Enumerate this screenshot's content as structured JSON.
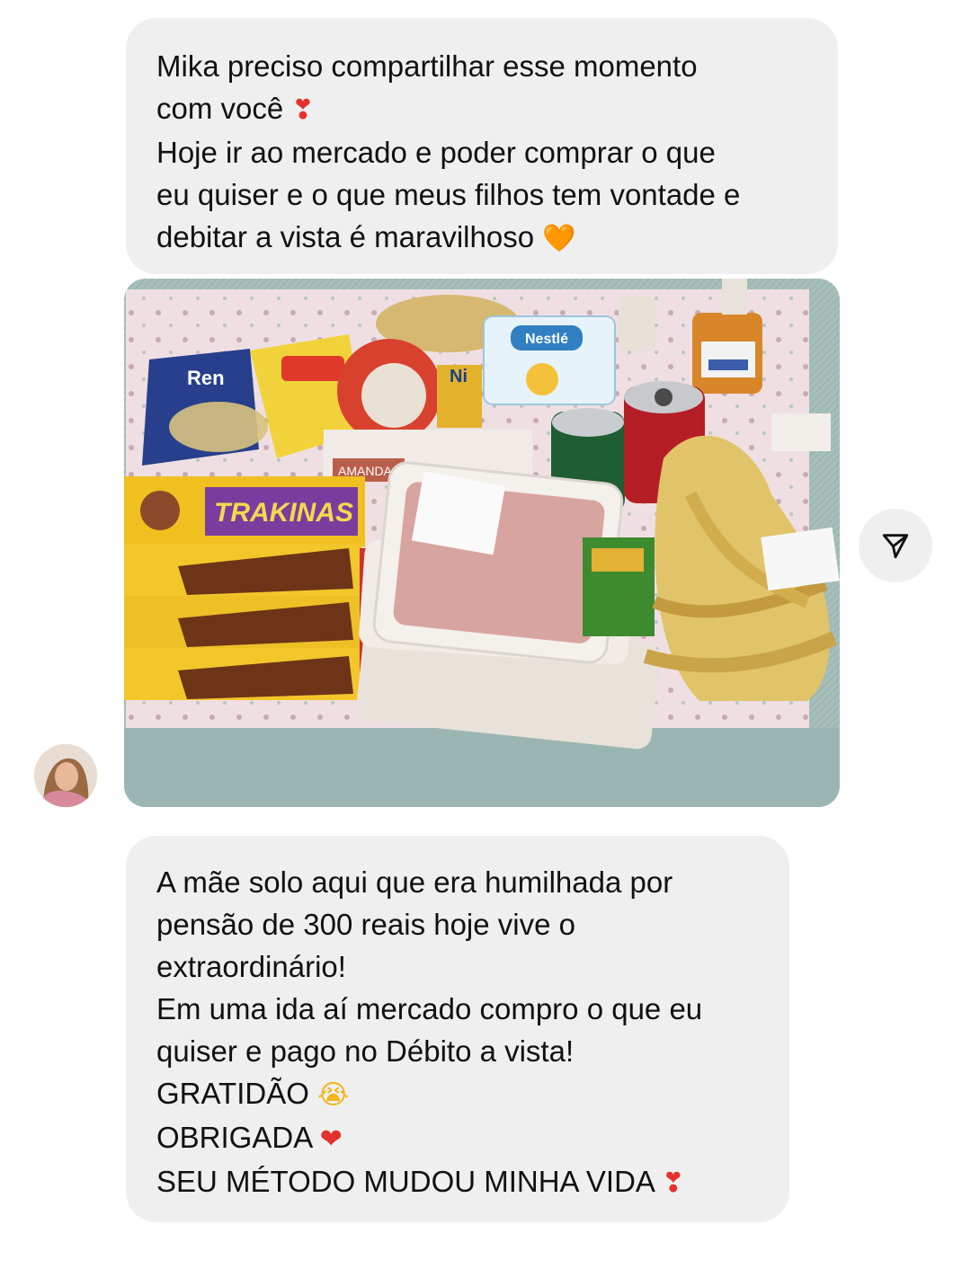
{
  "messages": [
    {
      "lines": [
        "Mika preciso compartilhar esse momento",
        "com você",
        "Hoje ir ao mercado e poder comprar o que",
        "eu quiser e o que meus filhos tem vontade e",
        "debitar a vista é maravilhoso"
      ],
      "emoji": [
        "❣",
        "🧡"
      ]
    },
    {
      "lines": [
        "A mãe solo aqui que era humilhada por",
        "pensão de 300 reais hoje vive o",
        "extraordinário!",
        "Em uma ida aí mercado compro o que eu",
        "quiser e pago no Débito a vista!",
        "GRATIDÃO",
        "OBRIGADA",
        "SEU MÉTODO MUDOU MINHA VIDA"
      ],
      "emoji": [
        "😭",
        "❤",
        "❣"
      ]
    }
  ],
  "photo": {
    "label_text": {
      "ren": "Ren",
      "nestle": "Nestlé",
      "ni": "Ni",
      "amanda": "AMANDA",
      "trakinas": "TRAKINAS"
    }
  },
  "icons": {
    "share": "paper-plane-icon",
    "avatar": "avatar"
  },
  "colors": {
    "bubble": "#efefef",
    "text": "#111111",
    "heart_red": "#e5312e",
    "heart_orange": "#ff8a1f"
  }
}
